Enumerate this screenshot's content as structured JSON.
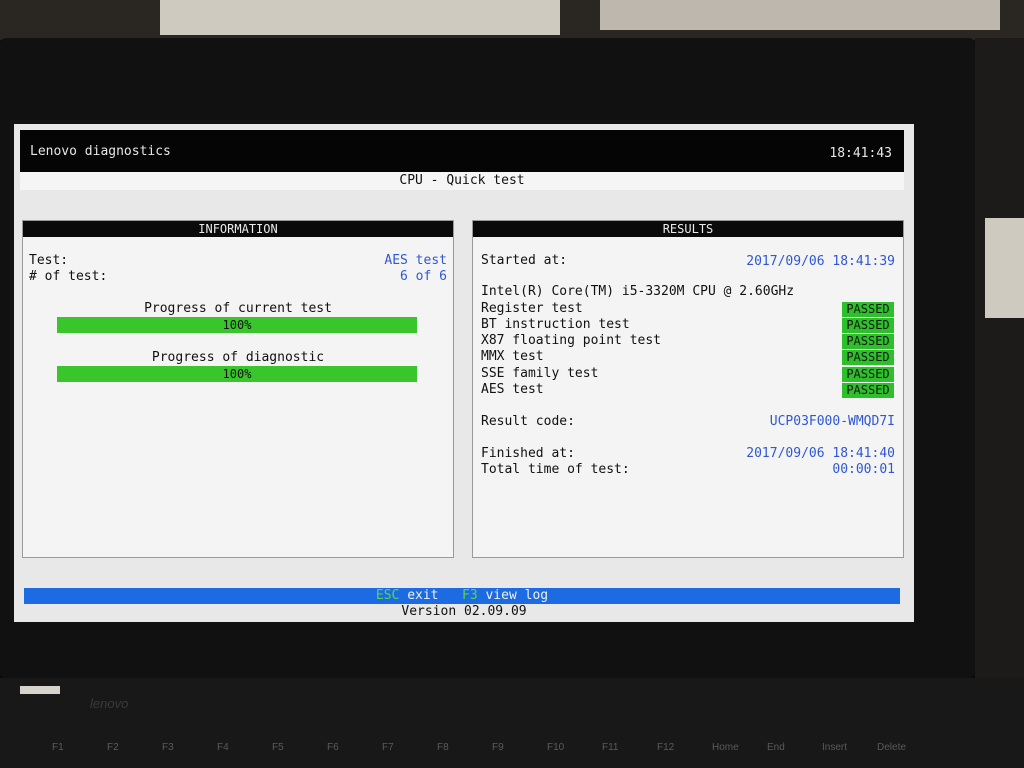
{
  "header": {
    "app_title": "Lenovo diagnostics",
    "time": "18:41:43",
    "subtitle": "CPU - Quick test"
  },
  "information": {
    "heading": "INFORMATION",
    "test_label": "Test:",
    "test_value": "AES test",
    "count_label": "# of test:",
    "count_value": "6 of 6",
    "progress_current_label": "Progress of current test",
    "progress_current_value": 100,
    "progress_current_text": "100%",
    "progress_diag_label": "Progress of diagnostic",
    "progress_diag_value": 100,
    "progress_diag_text": "100%"
  },
  "results": {
    "heading": "RESULTS",
    "started_label": "Started at:",
    "started_value": "2017/09/06 18:41:39",
    "cpu_name": "Intel(R) Core(TM) i5-3320M CPU @ 2.60GHz",
    "tests": [
      {
        "name": "Register test",
        "status": "PASSED"
      },
      {
        "name": "BT instruction test",
        "status": "PASSED"
      },
      {
        "name": "X87 floating point test",
        "status": "PASSED"
      },
      {
        "name": "MMX test",
        "status": "PASSED"
      },
      {
        "name": "SSE family test",
        "status": "PASSED"
      },
      {
        "name": "AES test",
        "status": "PASSED"
      }
    ],
    "result_code_label": "Result code:",
    "result_code_value": "UCP03F000-WMQD7I",
    "finished_label": "Finished at:",
    "finished_value": "2017/09/06 18:41:40",
    "total_label": "Total time of test:",
    "total_value": "00:00:01"
  },
  "footer": {
    "esc_key": "ESC",
    "esc_label": "exit",
    "f3_key": "F3",
    "f3_label": "view log",
    "version": "Version 02.09.09"
  },
  "colors": {
    "accent_blue": "#1d6be2",
    "pass_green": "#2fbf2c",
    "value_blue": "#2f57d6"
  },
  "laptop": {
    "brand": "lenovo",
    "fkeys": [
      "F1",
      "F2",
      "F3",
      "F4",
      "F5",
      "F6",
      "F7",
      "F8",
      "F9",
      "F10",
      "F11",
      "F12",
      "Home",
      "End",
      "Insert",
      "Delete"
    ]
  }
}
